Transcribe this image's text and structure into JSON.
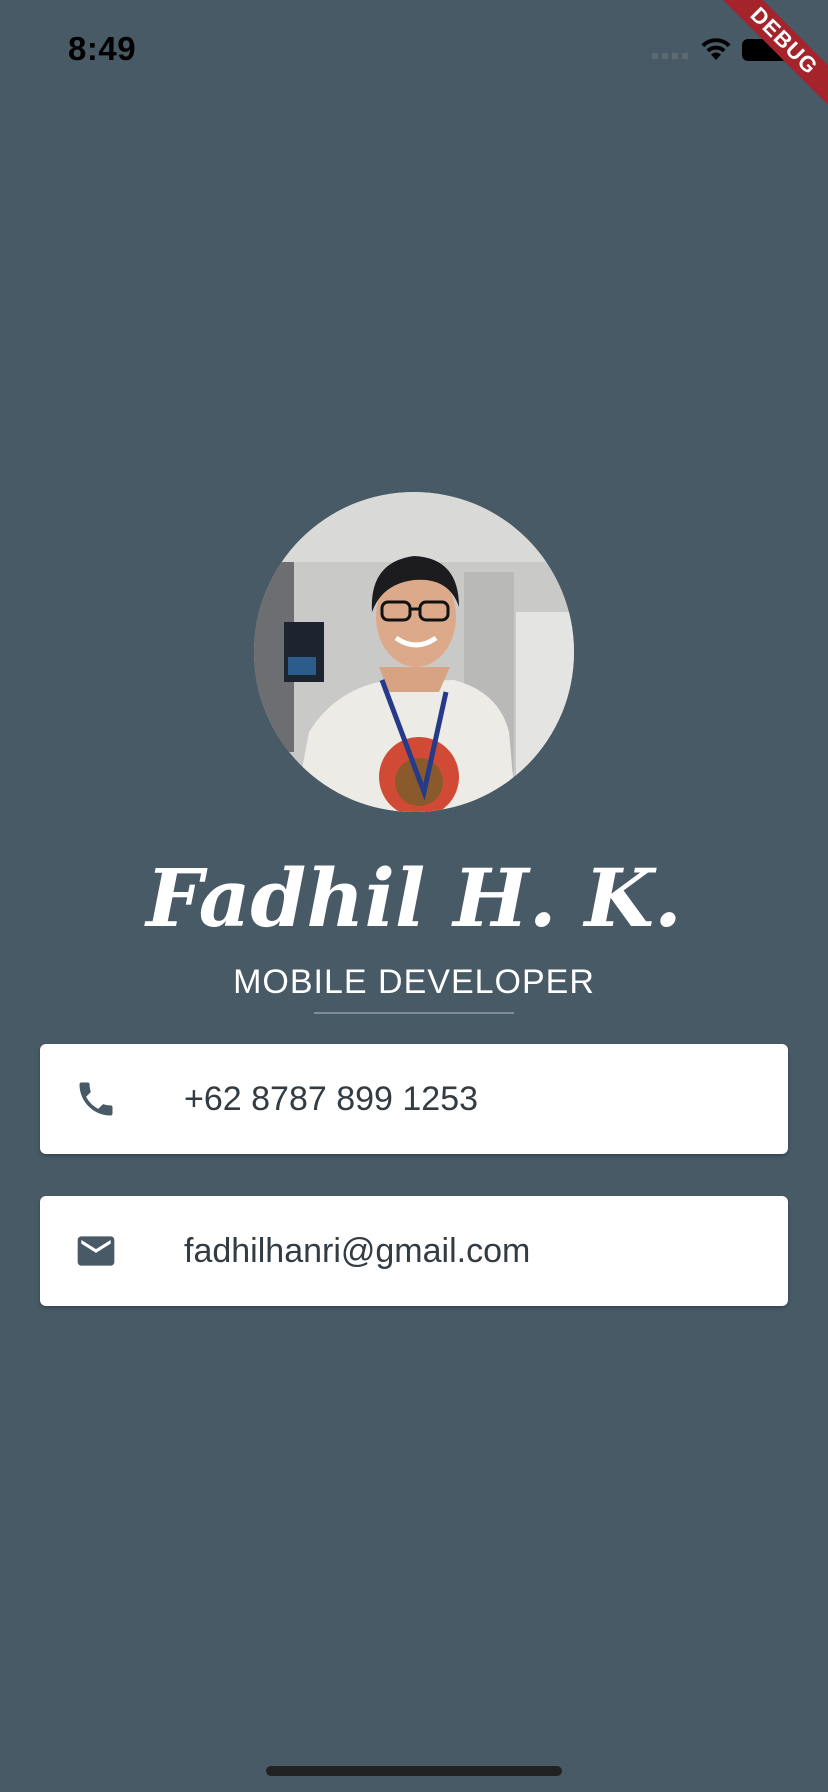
{
  "status_bar": {
    "time": "8:49"
  },
  "debug_banner": {
    "label": "DEBUG",
    "color": "#a5232b"
  },
  "profile": {
    "name": "Fadhil H. K.",
    "title": "MOBILE DEVELOPER"
  },
  "contacts": {
    "phone": {
      "icon": "phone-icon",
      "value": "+62 8787 899 1253"
    },
    "email": {
      "icon": "mail-icon",
      "value": "fadhilhanri@gmail.com"
    }
  },
  "colors": {
    "background": "#475a66",
    "card": "#ffffff",
    "icon": "#475a66",
    "text": "#333c43"
  }
}
